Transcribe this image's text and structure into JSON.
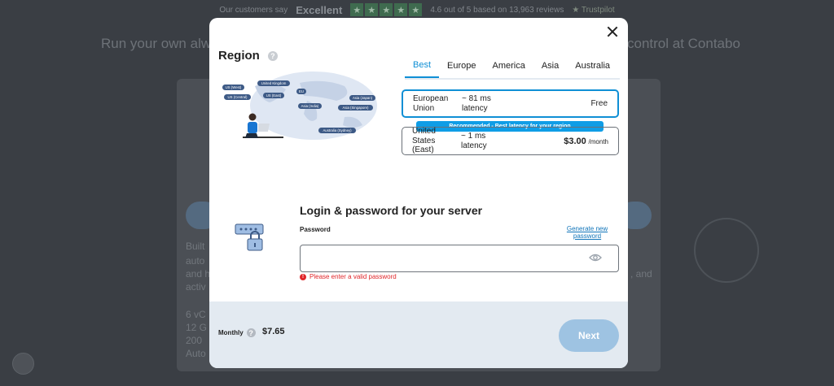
{
  "background": {
    "customers_say": "Our customers say",
    "excellent": "Excellent",
    "rating_text": "4.6 out of 5 based on 13,963 reviews",
    "trustpilot": "Trustpilot",
    "headline_left": "Run your own alw",
    "headline_right": "control at Contabo",
    "card_lines": [
      "Built",
      "auto",
      "and h",
      "activ"
    ],
    "spec_lines": [
      "6 vC",
      "12 G",
      "200",
      "Auto"
    ],
    "side_text": ", and"
  },
  "region": {
    "title": "Region",
    "help_glyph": "?",
    "map_labels": [
      "US (West)",
      "United Kingdom",
      "US (Central)",
      "US (East)",
      "EU",
      "Asia (India)",
      "Asia (Japan)",
      "Asia (Singapore)",
      "Australia (Sydney)"
    ],
    "tabs": [
      "Best",
      "Europe",
      "America",
      "Asia",
      "Australia"
    ],
    "options": [
      {
        "name_line1": "European",
        "name_line2": "Union",
        "latency_line1": "~ 81 ms",
        "latency_line2": "latency",
        "price": "Free",
        "price_unit": "",
        "selected": true
      },
      {
        "name_line1": "United States",
        "name_line2": "(East)",
        "latency_line1": "~ 1 ms",
        "latency_line2": "latency",
        "price": "$3.00",
        "price_unit": "/month",
        "selected": false
      }
    ],
    "recommended_badge": "Recommended - Best latency for your region"
  },
  "login": {
    "title": "Login & password for your server",
    "password_label": "Password",
    "generate_line1": "Generate new",
    "generate_line2": "password",
    "password_value": "",
    "error": "Please enter a valid password",
    "error_glyph": "!"
  },
  "footer": {
    "monthly_label": "Monthly",
    "help_glyph": "?",
    "price": "$7.65",
    "next_label": "Next"
  },
  "colors": {
    "accent": "#0f8fd5",
    "next_button": "#9ec3e2",
    "error": "#e0262a",
    "footer_bg": "#e3eaf1"
  }
}
